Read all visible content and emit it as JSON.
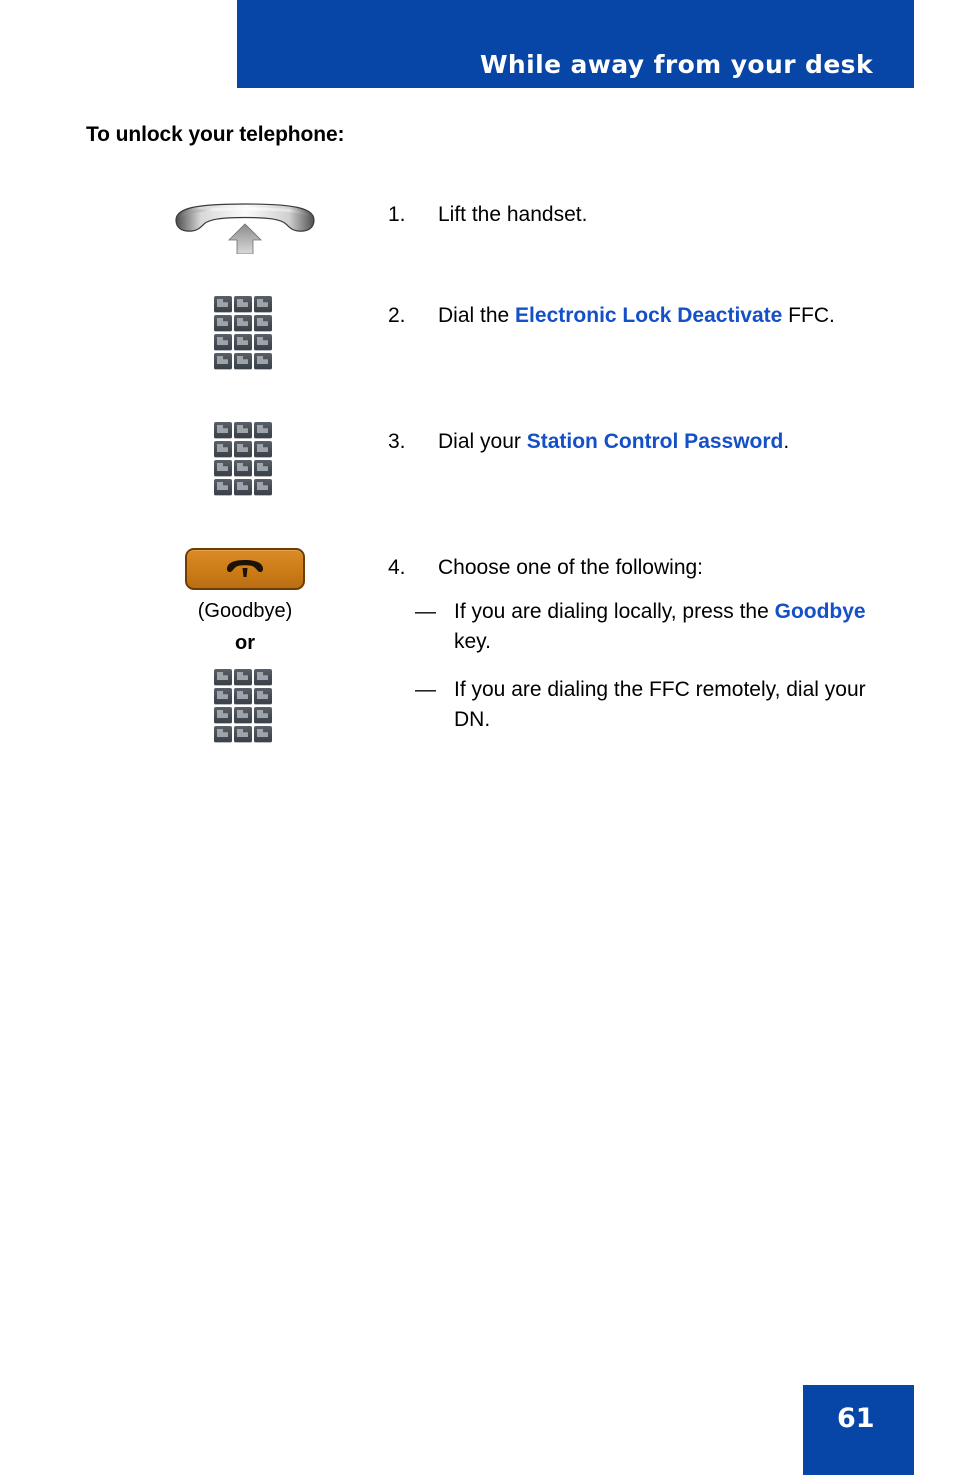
{
  "header": {
    "title": "While away from your desk",
    "bar_color": "#0745a6"
  },
  "section": {
    "heading": "To unlock your telephone:"
  },
  "colors": {
    "accent_blue": "#0745a6",
    "link_blue": "#1450c8",
    "goodbye_orange": "#cd7c17",
    "keypad_gray": "#464c54"
  },
  "steps": [
    {
      "number": "1.",
      "icon": "lift-handset-icon",
      "text_plain": "Lift the handset.",
      "parts": [
        {
          "text": "Lift the handset.",
          "style": "plain"
        }
      ]
    },
    {
      "number": "2.",
      "icon": "dialpad-icon",
      "text_plain": "Dial the Electronic Lock Deactivate FFC.",
      "parts": [
        {
          "text": "Dial the ",
          "style": "plain"
        },
        {
          "text": "Electronic Lock Deactivate",
          "style": "bold-blue"
        },
        {
          "text": " FFC.",
          "style": "plain"
        }
      ]
    },
    {
      "number": "3.",
      "icon": "dialpad-icon",
      "text_plain": "Dial your Station Control Password.",
      "parts": [
        {
          "text": "Dial your ",
          "style": "plain"
        },
        {
          "text": "Station Control Password",
          "style": "bold-blue"
        },
        {
          "text": ".",
          "style": "plain"
        }
      ]
    },
    {
      "number": "4.",
      "icon": "goodbye-key-or-dialpad",
      "text_plain": "Choose one of the following:",
      "parts": [
        {
          "text": "Choose one of the following:",
          "style": "plain"
        }
      ],
      "substeps": [
        {
          "dash": "—",
          "text_plain": "If you are dialing locally, press the Goodbye key.",
          "parts": [
            {
              "text": "If you are dialing locally, press the ",
              "style": "plain"
            },
            {
              "text": "Goodbye",
              "style": "bold-blue"
            },
            {
              "text": " key.",
              "style": "plain"
            }
          ]
        },
        {
          "dash": "—",
          "text_plain": "If you are dialing the FFC remotely, dial your DN.",
          "parts": [
            {
              "text": "If you are dialing the FFC remotely, dial your DN.",
              "style": "plain"
            }
          ]
        }
      ]
    }
  ],
  "goodbye": {
    "caption": "(Goodbye)",
    "or_label": "or",
    "icon": "goodbye-key-icon"
  },
  "footer": {
    "page_number": "61"
  }
}
